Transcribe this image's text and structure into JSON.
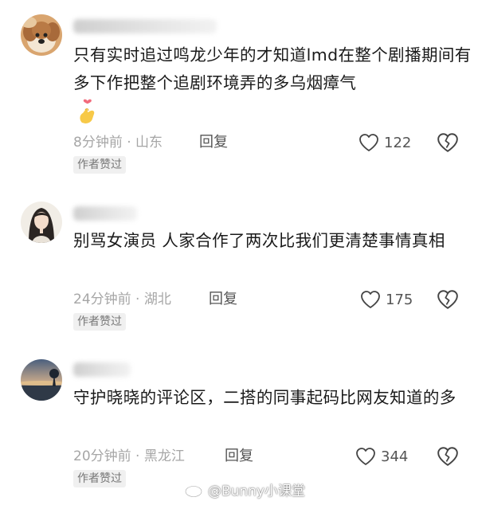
{
  "comments": [
    {
      "text": "只有实时追过鸣龙少年的才知道lmd在整个剧播期间有多下作把整个追剧环境弄的多乌烟瘴气",
      "emoji": "finger-heart-emoji",
      "time": "8分钟前",
      "location": "山东",
      "reply_label": "回复",
      "likes": "122",
      "author_tag": "作者赞过"
    },
    {
      "text": "别骂女演员 人家合作了两次比我们更清楚事情真相",
      "time": "24分钟前",
      "location": "湖北",
      "reply_label": "回复",
      "likes": "175",
      "author_tag": "作者赞过"
    },
    {
      "text": "守护晓晓的评论区，二搭的同事起码比网友知道的多",
      "time": "20分钟前",
      "location": "黑龙江",
      "reply_label": "回复",
      "likes": "344",
      "author_tag": "作者赞过"
    }
  ],
  "meta_separator": "·",
  "watermark": {
    "text": "@Bunny小课堂",
    "icon": "weibo-icon"
  },
  "colors": {
    "text": "#1a1a1a",
    "meta": "#a6a6a6",
    "tag_bg": "#f0f0f0",
    "emoji_heart": "#f26b7c",
    "emoji_hand": "#f7c948"
  }
}
